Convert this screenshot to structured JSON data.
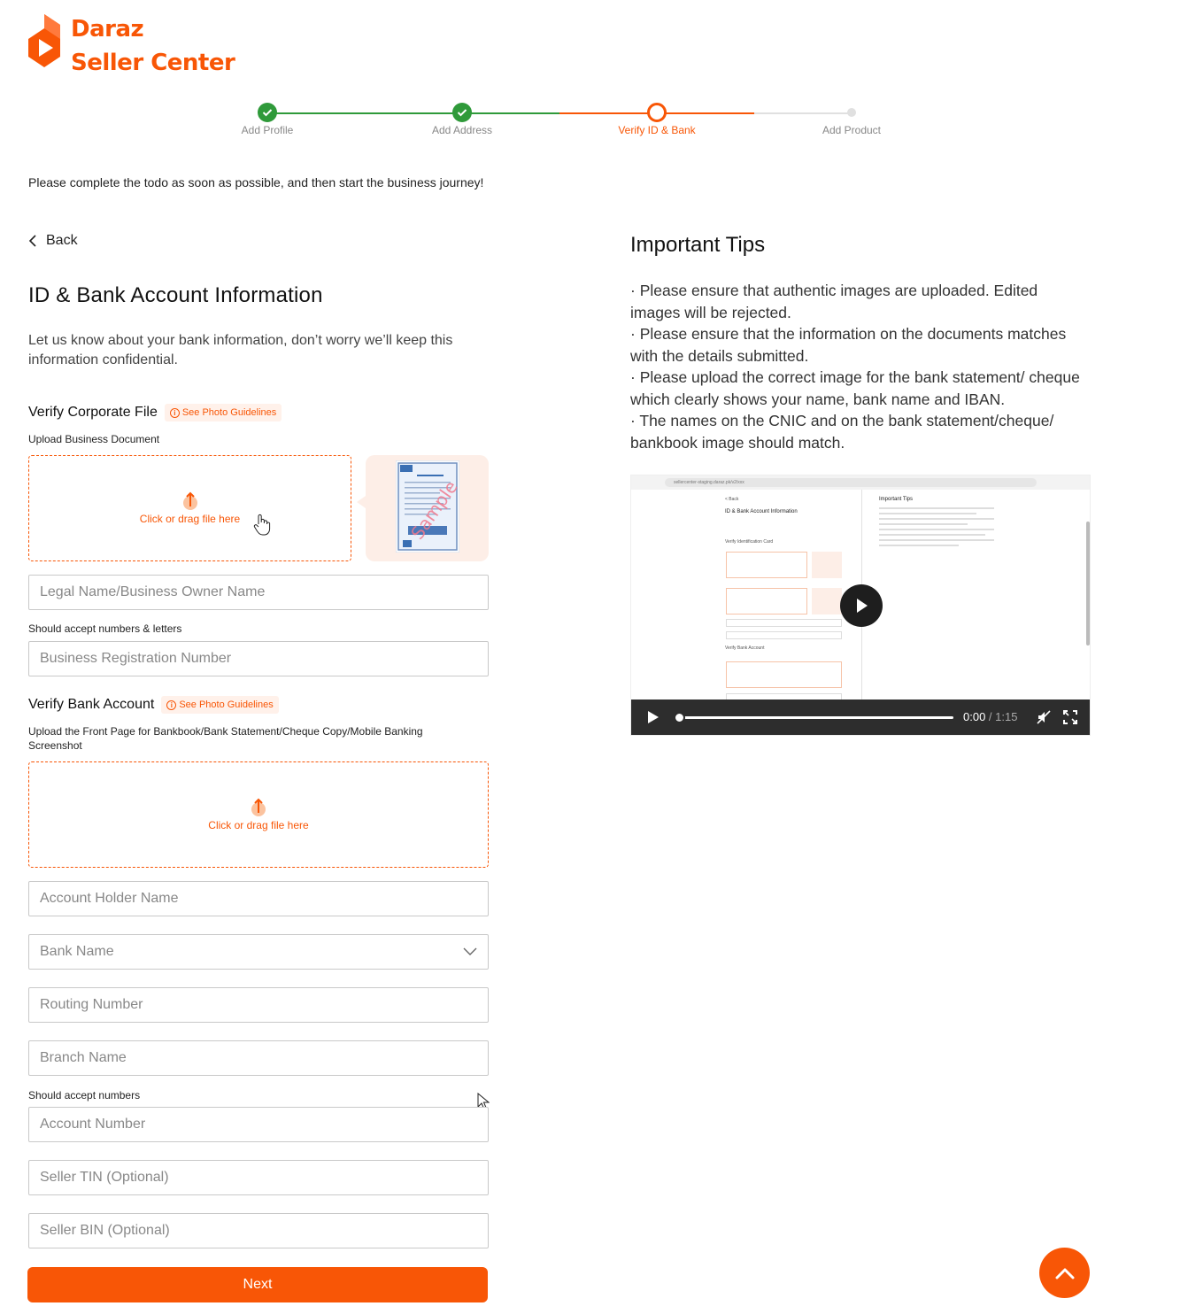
{
  "brand": {
    "line1": "Daraz",
    "line2": "Seller Center",
    "accent": "#f85606",
    "success": "#2f9a3a"
  },
  "steps": [
    {
      "label": "Add Profile",
      "state": "done"
    },
    {
      "label": "Add Address",
      "state": "done"
    },
    {
      "label": "Verify ID & Bank",
      "state": "current"
    },
    {
      "label": "Add Product",
      "state": "todo"
    }
  ],
  "intro": "Please complete the todo as soon as possible, and then start the business journey!",
  "back_label": "Back",
  "form": {
    "title": "ID & Bank Account Information",
    "description": "Let us know about your bank information, don’t worry we’ll keep this information confidential.",
    "corporate": {
      "title": "Verify Corporate File",
      "guideline": "See Photo Guidelines",
      "upload_label": "Upload Business Document",
      "upload_text": "Click or drag file here",
      "sample_watermark": "Sample"
    },
    "legal_name_placeholder": "Legal Name/Business Owner Name",
    "reg_helper": "Should accept numbers & letters",
    "reg_number_placeholder": "Business Registration Number",
    "bank": {
      "title": "Verify Bank Account",
      "guideline": "See Photo Guidelines",
      "upload_label": "Upload the Front Page for Bankbook/Bank Statement/Cheque Copy/Mobile Banking Screenshot",
      "upload_text": "Click or drag file here"
    },
    "account_holder_placeholder": "Account Holder Name",
    "bank_name_placeholder": "Bank Name",
    "routing_placeholder": "Routing Number",
    "branch_placeholder": "Branch Name",
    "account_helper": "Should accept numbers",
    "account_number_placeholder": "Account Number",
    "tin_placeholder": "Seller TIN (Optional)",
    "bin_placeholder": "Seller BIN (Optional)",
    "next_label": "Next"
  },
  "tips": {
    "title": "Important Tips",
    "items": [
      "· Please ensure that authentic images are uploaded. Edited images will be rejected.",
      "· Please ensure that the information on the documents matches with the details submitted.",
      "· Please upload the correct image for the bank statement/ cheque which clearly shows your name, bank name and IBAN.",
      "· The names on the CNIC and on the bank statement/cheque/ bankbook image should match."
    ]
  },
  "video": {
    "current_time": "0:00",
    "separator": " / ",
    "duration": "1:15",
    "progress": 0,
    "preview": {
      "url": "sellercenter-staging.daraz.pk/v2/xxx",
      "back": "< Back",
      "title": "ID & Bank Account Information",
      "tips_title": "Important Tips",
      "id_section": "Verify Identification Card",
      "bank_section": "Verify Bank Account"
    }
  }
}
